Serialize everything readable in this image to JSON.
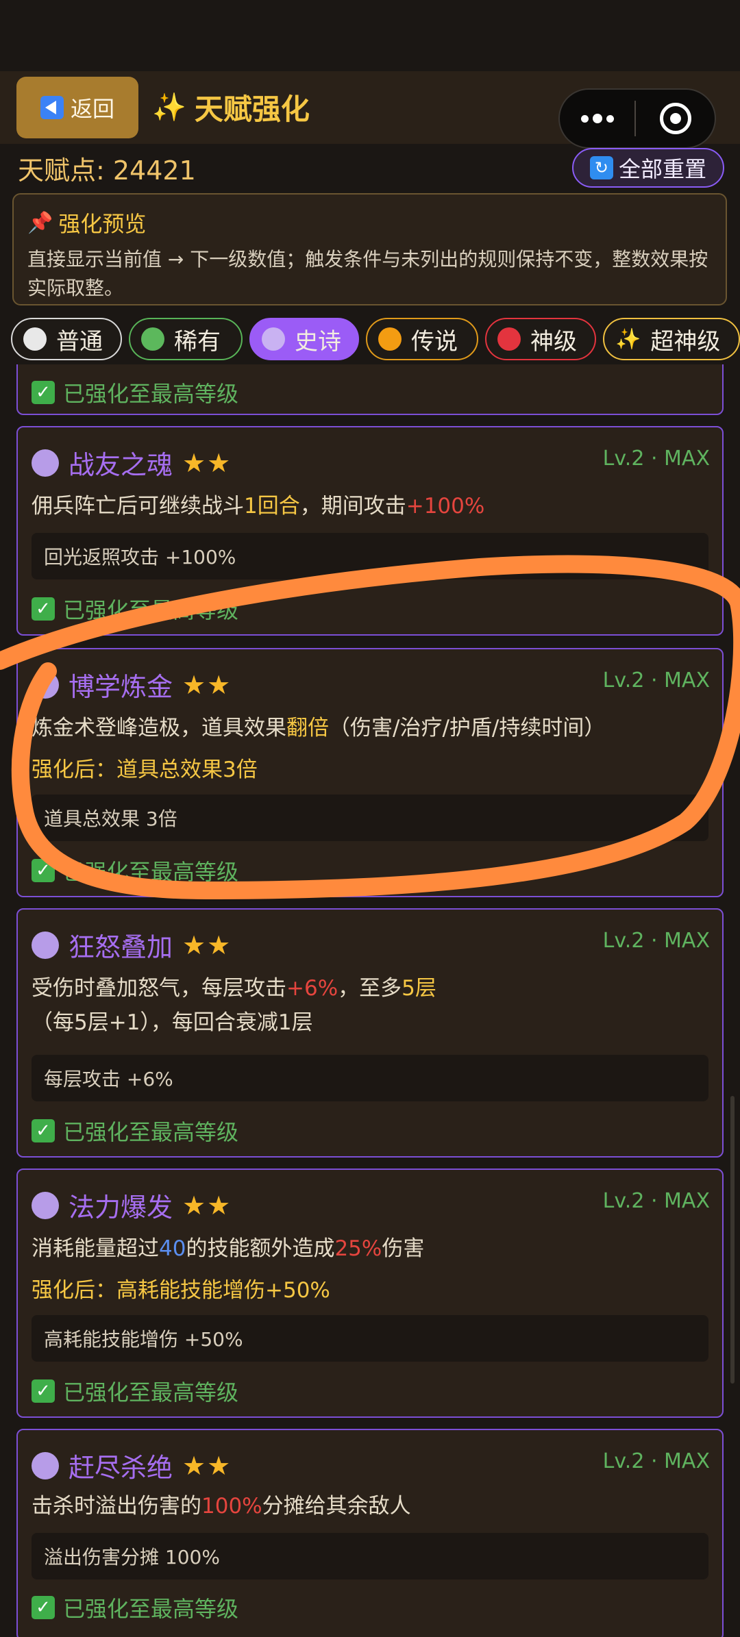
{
  "header": {
    "back_label": "返回",
    "title": "天赋强化",
    "title_icon": "sparkle-icon",
    "capsule_icons": [
      "more-dots-icon",
      "close-target-icon"
    ]
  },
  "points": {
    "label": "天赋点: 24421"
  },
  "reset": {
    "label": "全部重置",
    "icon": "refresh-icon"
  },
  "preview": {
    "icon": "pushpin-icon",
    "title": "强化预览",
    "text": "直接显示当前值 → 下一级数值；触发条件与未列出的规则保持不变，整数效果按实际取整。"
  },
  "tabs": [
    {
      "label": "普通",
      "color": "#e8e8e8"
    },
    {
      "label": "稀有",
      "color": "#5cb85c"
    },
    {
      "label": "史诗",
      "color": "#b79ce8",
      "selected": true
    },
    {
      "label": "传说",
      "color": "#f39c12"
    },
    {
      "label": "神级",
      "color": "#e3343e"
    },
    {
      "label": "超神级",
      "icon": "sparkle-icon"
    }
  ],
  "maxed_label": "已强化至最高等级",
  "cards": [
    {
      "name": "战友之魂",
      "stars": "★★",
      "level": "Lv.2 · MAX",
      "desc_a": "佣兵阵亡后可继续战斗",
      "desc_b": "1回合",
      "desc_c": "，期间攻击",
      "desc_d": "+100%",
      "box": "回光返照攻击 +100%"
    },
    {
      "name": "博学炼金",
      "stars": "★★",
      "level": "Lv.2 · MAX",
      "desc_a": "炼金术登峰造极，道具效果",
      "desc_b": "翻倍",
      "desc_c": "（伤害/治疗/护盾/持续时间）",
      "enh": "强化后：道具总效果3倍",
      "box": "道具总效果 3倍"
    },
    {
      "name": "狂怒叠加",
      "stars": "★★",
      "level": "Lv.2 · MAX",
      "desc_a": "受伤时叠加怒气，每层攻击",
      "desc_b": "+6%",
      "desc_c": "，至多",
      "desc_d": "5层",
      "desc_e": "（每5层+1），每回合衰减1层",
      "box": "每层攻击 +6%"
    },
    {
      "name": "法力爆发",
      "stars": "★★",
      "level": "Lv.2 · MAX",
      "desc_a": "消耗能量超过",
      "desc_b": "40",
      "desc_c": "的技能额外造成",
      "desc_d": "25%",
      "desc_e": "伤害",
      "enh": "强化后：高耗能技能增伤+50%",
      "box": "高耗能技能增伤 +50%"
    },
    {
      "name": "赶尽杀绝",
      "stars": "★★",
      "level": "Lv.2 · MAX",
      "desc_a": "击杀时溢出伤害的",
      "desc_b": "100%",
      "desc_c": "分摊给其余敌人",
      "box": "溢出伤害分摊 100%"
    }
  ],
  "colors": {
    "accent_gold": "#f6c744",
    "epic_purple": "#9b5cf6",
    "maxed_green": "#5fb35f",
    "highlight_red": "#e5453e",
    "annotation_orange": "#ff8a3d"
  }
}
